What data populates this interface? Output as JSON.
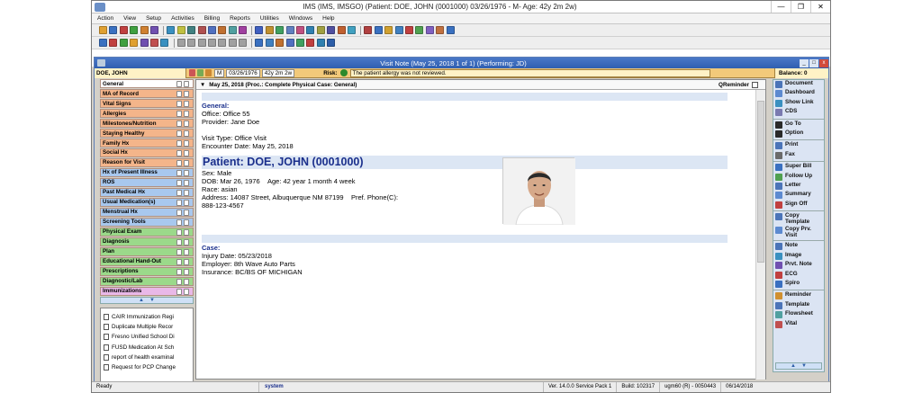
{
  "window": {
    "title": "IMS (IMS, IMSGO)    (Patient: DOE, JOHN  (0001000) 03/26/1976 - M- Age: 42y 2m 2w)"
  },
  "menu": [
    "Action",
    "View",
    "Setup",
    "Activities",
    "Billing",
    "Reports",
    "Utilities",
    "Windows",
    "Help"
  ],
  "visit_window": {
    "title": "Visit Note (May 25, 2018    1 of 1) (Performing: JD)"
  },
  "patient_bar": {
    "name": "DOE, JOHN",
    "sex": "M",
    "dob": "03/26/1976",
    "age": "42y 2m 2w",
    "risk_label": "Risk:",
    "allergy_msg": "The patient allergy was not reviewed.",
    "balance": "Balance: 0"
  },
  "sections": [
    {
      "label": "General",
      "color": "general",
      "active": true
    },
    {
      "label": "MA of Record",
      "color": "orange"
    },
    {
      "label": "Vital Signs",
      "color": "orange"
    },
    {
      "label": "Allergies",
      "color": "orange"
    },
    {
      "label": "Milestones/Nutrition",
      "color": "orange"
    },
    {
      "label": "Staying Healthy",
      "color": "orange"
    },
    {
      "label": "Family Hx",
      "color": "orange"
    },
    {
      "label": "Social Hx",
      "color": "orange"
    },
    {
      "label": "Reason for Visit",
      "color": "orange"
    },
    {
      "label": "Hx of Present Illness",
      "color": "blue"
    },
    {
      "label": "ROS",
      "color": "blue"
    },
    {
      "label": "Past Medical Hx",
      "color": "blue"
    },
    {
      "label": "Usual Medication(s)",
      "color": "blue"
    },
    {
      "label": "Menstrual Hx",
      "color": "blue"
    },
    {
      "label": "Screening Tools",
      "color": "blue"
    },
    {
      "label": "Physical Exam",
      "color": "green"
    },
    {
      "label": "Diagnosis",
      "color": "green"
    },
    {
      "label": "Plan",
      "color": "green"
    },
    {
      "label": "Educational Hand-Out",
      "color": "green"
    },
    {
      "label": "Prescriptions",
      "color": "green"
    },
    {
      "label": "Diagnostic/Lab",
      "color": "green"
    },
    {
      "label": "Immunizations",
      "color": "pink"
    }
  ],
  "documents": [
    "CAIR Immunization Regi",
    "Duplicate Multiple Recor",
    "Fresno Unified School Di",
    "FUSD Medication At Sch",
    "report of health examinal",
    "Request for PCP Change"
  ],
  "note": {
    "header": "May 25, 2018   (Proc.: Complete Physical  Case: General)",
    "qreminder": "QReminder",
    "general_label": "General:",
    "office": "Office: Office 55",
    "provider": "Provider: Jane Doe",
    "visit_type": "Visit Type: Office Visit",
    "encounter_date": "Encounter Date: May 25, 2018",
    "patient_heading": "Patient: DOE, JOHN    (0001000)",
    "sex": "Sex: Male",
    "dob": "DOB: Mar 26, 1976",
    "age": "Age: 42 year 1 month 4 week",
    "race": "Race: asian",
    "address": "Address: 14087 Street, Albuquerque  NM  87199",
    "pref_phone": "Pref. Phone(C):",
    "phone": "888-123-4567",
    "case_label": "Case:",
    "injury_date": "Injury Date: 05/23/2018",
    "employer": "Employer: 8th Wave Auto Parts",
    "insurance": "Insurance: BC/BS OF MICHIGAN"
  },
  "right_actions": [
    {
      "label": "Document",
      "icon": "document-icon"
    },
    {
      "label": "Dashboard",
      "icon": "dashboard-icon"
    },
    {
      "label": "Show Link",
      "icon": "link-icon"
    },
    {
      "label": "CDS",
      "icon": "cds-icon"
    },
    {
      "label": "Go To",
      "icon": "goto-icon",
      "sep_before": true
    },
    {
      "label": "Option",
      "icon": "option-icon"
    },
    {
      "label": "Print",
      "icon": "print-icon",
      "sep_before": true
    },
    {
      "label": "Fax",
      "icon": "fax-icon"
    },
    {
      "label": "Super Bill",
      "icon": "superbill-icon",
      "sep_before": true
    },
    {
      "label": "Follow Up",
      "icon": "followup-icon"
    },
    {
      "label": "Letter",
      "icon": "letter-icon"
    },
    {
      "label": "Summary",
      "icon": "summary-icon"
    },
    {
      "label": "Sign Off",
      "icon": "signoff-icon"
    },
    {
      "label": "Copy Template",
      "icon": "copy-template-icon",
      "sep_before": true
    },
    {
      "label": "Copy Prv. Visit",
      "icon": "copy-visit-icon"
    },
    {
      "label": "Note",
      "icon": "note-icon",
      "sep_before": true
    },
    {
      "label": "Image",
      "icon": "image-icon"
    },
    {
      "label": "Prvt. Note",
      "icon": "private-note-icon"
    },
    {
      "label": "ECG",
      "icon": "ecg-icon"
    },
    {
      "label": "Spiro",
      "icon": "spiro-icon"
    },
    {
      "label": "Reminder",
      "icon": "reminder-icon",
      "sep_before": true
    },
    {
      "label": "Template",
      "icon": "template-icon"
    },
    {
      "label": "Flowsheet",
      "icon": "flowsheet-icon"
    },
    {
      "label": "Vital",
      "icon": "vital-icon"
    }
  ],
  "status": {
    "ready": "Ready",
    "user": "system",
    "version": "Ver. 14.0.0 Service Pack 1",
    "build": "Build: 102317",
    "server": "ugm60 (R) - 0050443",
    "date": "06/14/2018"
  },
  "colors": {
    "general": "#e8e8e8",
    "orange": "#f4b58a",
    "blue": "#a8c8ee",
    "green": "#9bd98a",
    "pink": "#e9b8e8"
  }
}
